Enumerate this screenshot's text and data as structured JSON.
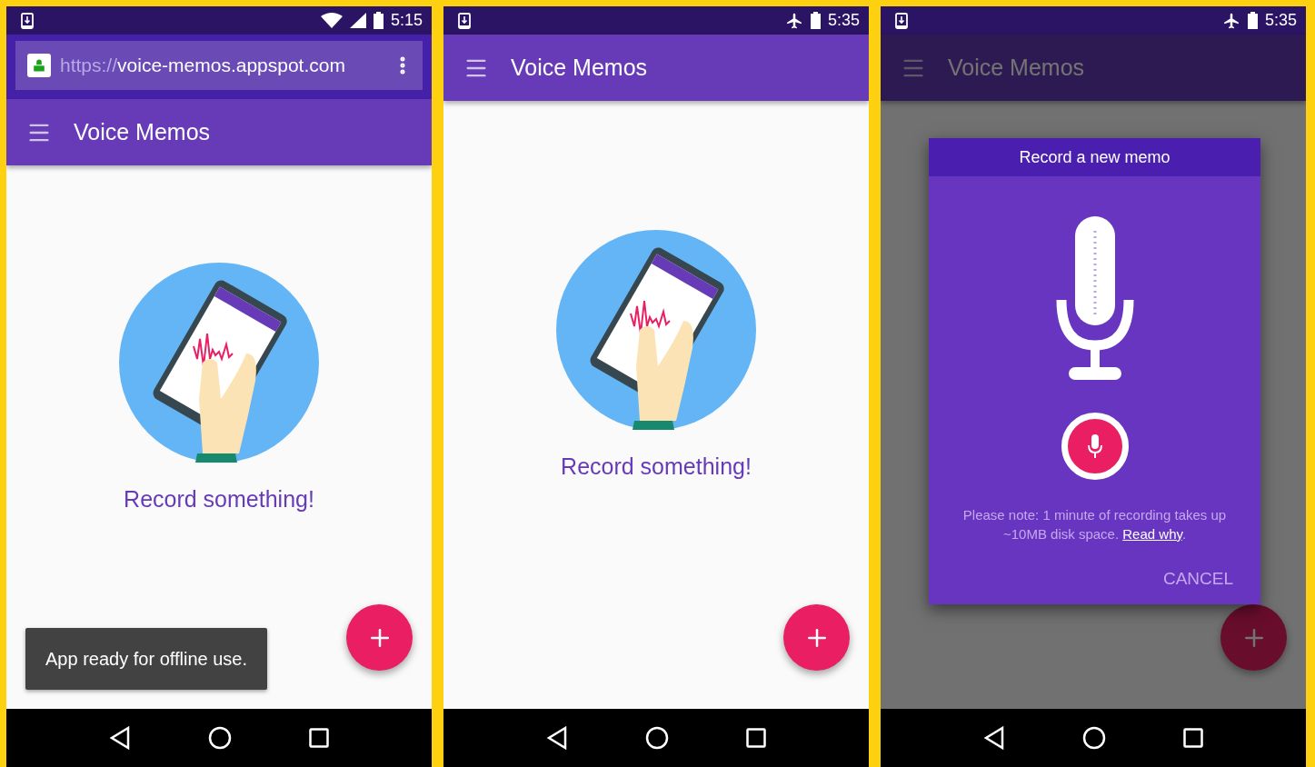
{
  "screens": [
    {
      "status_bar": {
        "time": "5:15",
        "kind": "wifi"
      },
      "url_bar": {
        "scheme": "https://",
        "host": "voice-memos.appspot.com"
      },
      "app_bar": {
        "title": "Voice Memos"
      },
      "empty_state": {
        "message": "Record something!"
      },
      "toast": "App ready for offline use.",
      "dimmed": false
    },
    {
      "status_bar": {
        "time": "5:35",
        "kind": "airplane"
      },
      "app_bar": {
        "title": "Voice Memos"
      },
      "empty_state": {
        "message": "Record something!"
      },
      "dimmed": false
    },
    {
      "status_bar": {
        "time": "5:35",
        "kind": "airplane"
      },
      "app_bar": {
        "title": "Voice Memos"
      },
      "dimmed": true,
      "dialog": {
        "title": "Record a new memo",
        "note": "Please note: 1 minute of recording takes up ~10MB disk space.",
        "link": "Read why",
        "note_end": ".",
        "cancel": "CANCEL"
      }
    }
  ]
}
